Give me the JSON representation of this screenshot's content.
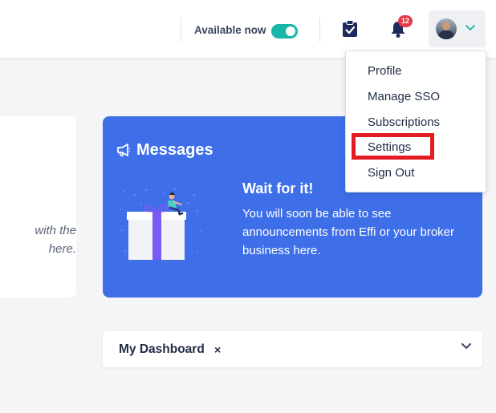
{
  "header": {
    "availability_label": "Available now",
    "availability_on": true,
    "notification_count": "12",
    "icons": [
      "clipboard-check-icon",
      "bell-icon",
      "chevron-down-icon"
    ]
  },
  "profile_menu": {
    "items": [
      "Profile",
      "Manage SSO",
      "Subscriptions",
      "Settings",
      "Sign Out"
    ],
    "highlighted": "Settings"
  },
  "left_card": {
    "text_line1": "with the",
    "text_line2": "here."
  },
  "messages": {
    "title": "Messages",
    "heading": "Wait for it!",
    "body": "You will soon be able to see announcements from Effi or your broker business here.",
    "icon": "megaphone-icon",
    "illustration": "gift-illustration"
  },
  "dashboard": {
    "title": "My Dashboard",
    "close_symbol": "×"
  },
  "colors": {
    "accent_teal": "#18b6a6",
    "messages_blue": "#3e6ee8",
    "badge_red": "#e23b4a",
    "highlight_red": "#e31b23"
  }
}
